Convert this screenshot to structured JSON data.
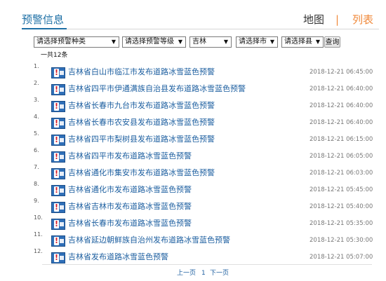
{
  "header": {
    "title": "预警信息",
    "tab_map": "地图",
    "separator": "|",
    "tab_list": "列表",
    "accent_color": "#1d6fa5",
    "active_color": "#f08a3c"
  },
  "filters": {
    "type": "请选择预警种类",
    "level": "请选择预警等级",
    "province": "吉林",
    "city": "请选择市",
    "county": "请选择县",
    "query_button": "查询"
  },
  "summary": {
    "total_text": "一共12条"
  },
  "alerts": [
    {
      "index": "1.",
      "title": "吉林省白山市临江市发布道路冰雪蓝色预警",
      "time": "2018-12-21 06:45:00"
    },
    {
      "index": "2.",
      "title": "吉林省四平市伊通满族自治县发布道路冰雪蓝色预警",
      "time": "2018-12-21 06:40:00"
    },
    {
      "index": "3.",
      "title": "吉林省长春市九台市发布道路冰雪蓝色预警",
      "time": "2018-12-21 06:40:00"
    },
    {
      "index": "4.",
      "title": "吉林省长春市农安县发布道路冰雪蓝色预警",
      "time": "2018-12-21 06:40:00"
    },
    {
      "index": "5.",
      "title": "吉林省四平市梨树县发布道路冰雪蓝色预警",
      "time": "2018-12-21 06:15:00"
    },
    {
      "index": "6.",
      "title": "吉林省四平市发布道路冰雪蓝色预警",
      "time": "2018-12-21 06:05:00"
    },
    {
      "index": "7.",
      "title": "吉林省通化市集安市发布道路冰雪蓝色预警",
      "time": "2018-12-21 06:03:00"
    },
    {
      "index": "8.",
      "title": "吉林省通化市发布道路冰雪蓝色预警",
      "time": "2018-12-21 05:45:00"
    },
    {
      "index": "9.",
      "title": "吉林省吉林市发布道路冰雪蓝色预警",
      "time": "2018-12-21 05:40:00"
    },
    {
      "index": "10.",
      "title": "吉林省长春市发布道路冰雪蓝色预警",
      "time": "2018-12-21 05:35:00"
    },
    {
      "index": "11.",
      "title": "吉林省延边朝鲜族自治州发布道路冰雪蓝色预警",
      "time": "2018-12-21 05:30:00"
    },
    {
      "index": "12.",
      "title": "吉林省发布道路冰雪蓝色预警",
      "time": "2018-12-21 05:07:00"
    }
  ],
  "pager": {
    "prev": "上一页",
    "current": "1",
    "next": "下一页"
  },
  "icons": {
    "alert": "blue-warning-icon",
    "dropdown": "chevron-down-icon"
  }
}
